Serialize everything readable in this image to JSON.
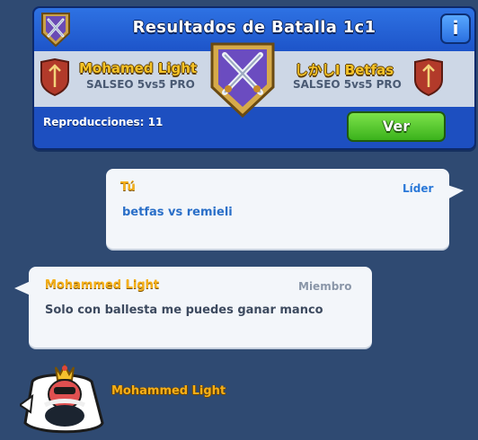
{
  "battle": {
    "title": "Resultados de Batalla 1c1",
    "info_label": "i",
    "left_player": {
      "name": "Mohamed Light",
      "clan": "SALSEO 5vs5 PRO"
    },
    "right_player": {
      "name": "しかしI Betfas",
      "clan": "SALSEO 5vs5 PRO"
    },
    "replays_label": "Reproducciones: 11",
    "watch_label": "Ver"
  },
  "messages": [
    {
      "author": "Tú",
      "role": "Líder",
      "text": "betfas vs remieli"
    },
    {
      "author": "Mohammed Light",
      "role": "Miembro",
      "text": "Solo con ballesta me puedes ganar manco"
    }
  ],
  "footer": {
    "name": "Mohammed Light"
  },
  "colors": {
    "background": "#2f4a72",
    "card_blue": "#1d4fc0",
    "gold_text": "#f6c327",
    "leader_blue": "#2a78d8",
    "member_grey": "#8a96a8",
    "green_button": "#3bb21c"
  },
  "icons": [
    "crossed-swords-badge-icon",
    "info-icon",
    "shield-icon",
    "king-emote-icon"
  ]
}
